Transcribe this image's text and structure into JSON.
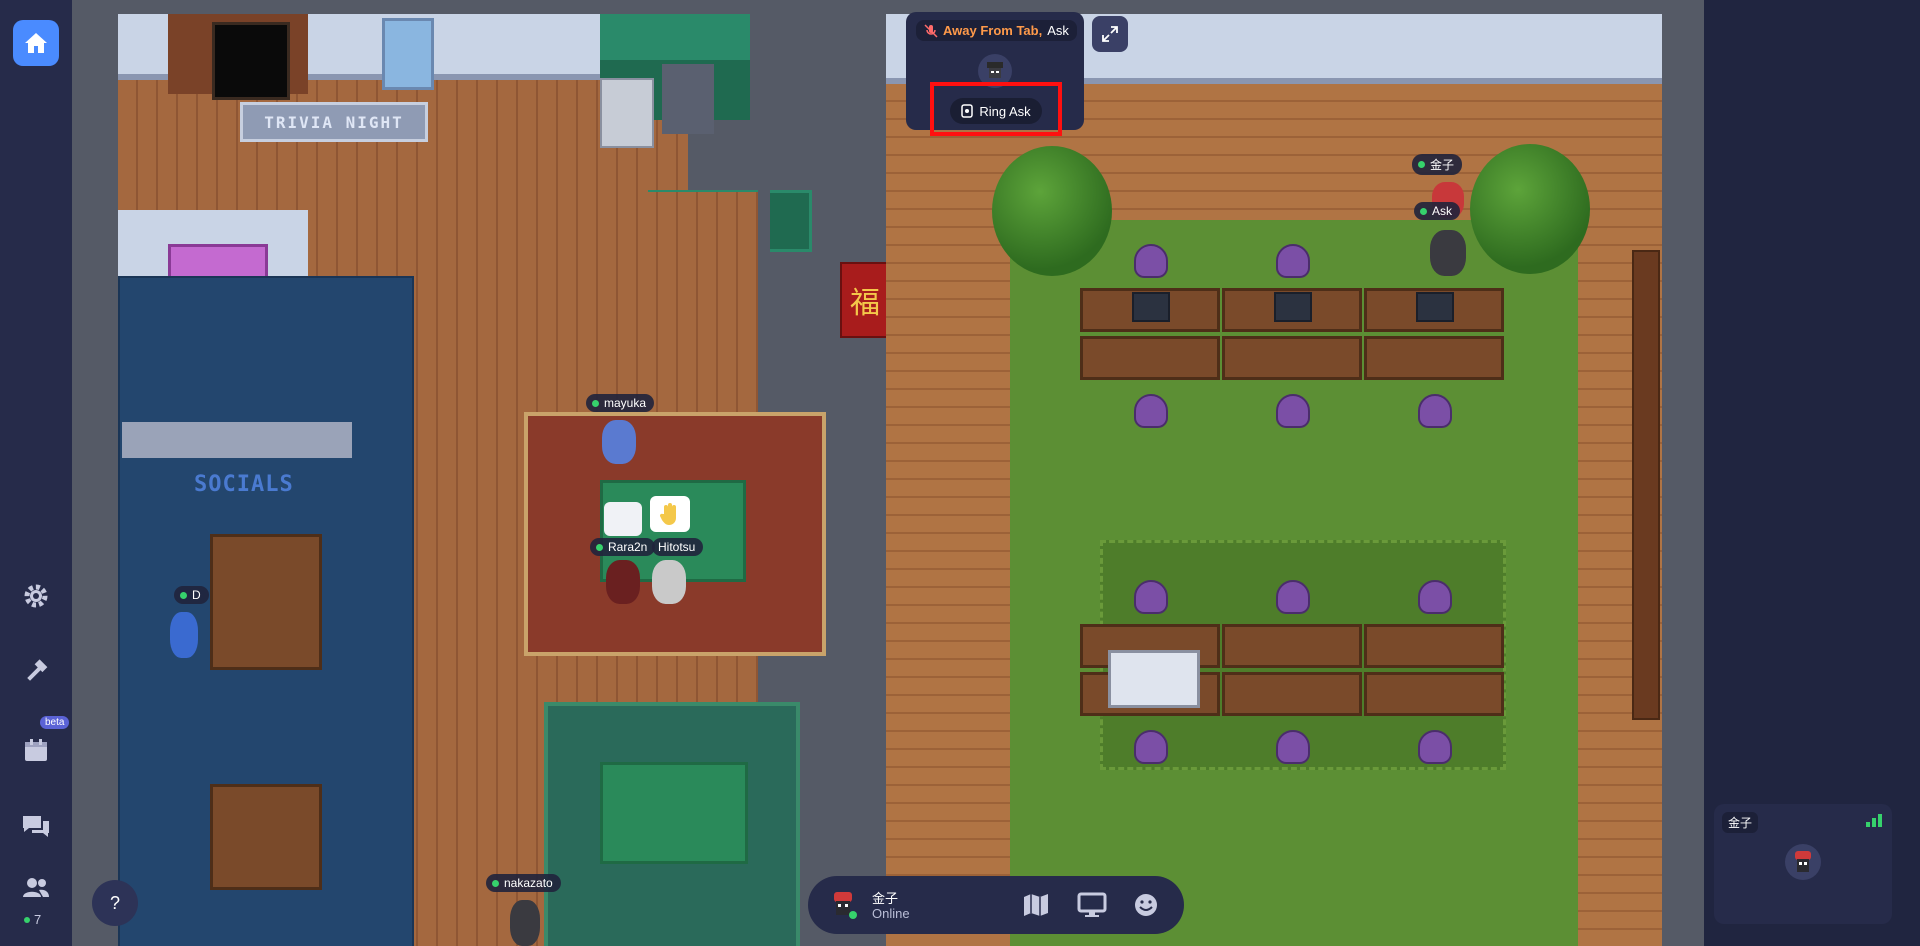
{
  "sidebar": {
    "online_count": "7",
    "beta_badge": "beta",
    "help_label": "?"
  },
  "map": {
    "trivia_sign": "TRIVIA NIGHT",
    "socials_sign": "SOCIALS",
    "fu_banner": "福",
    "player_labels": [
      {
        "name": "金子"
      },
      {
        "name": "Ask"
      },
      {
        "name": "mayuka"
      },
      {
        "name": "Rara2n"
      },
      {
        "name": "Hitotsu"
      },
      {
        "name": "D"
      },
      {
        "name": "nakazato"
      }
    ]
  },
  "popup": {
    "status_label": "Away From Tab,",
    "status_name": "Ask",
    "ring_button_label": "Ring Ask"
  },
  "bottombar": {
    "user_name": "金子",
    "user_status": "Online"
  },
  "video_card": {
    "name": "金子"
  },
  "colors": {
    "accent": "#4a8bff",
    "online": "#36d26c",
    "panel": "#262b4a",
    "highlight": "#ff1010",
    "away": "#ff9a4a"
  }
}
